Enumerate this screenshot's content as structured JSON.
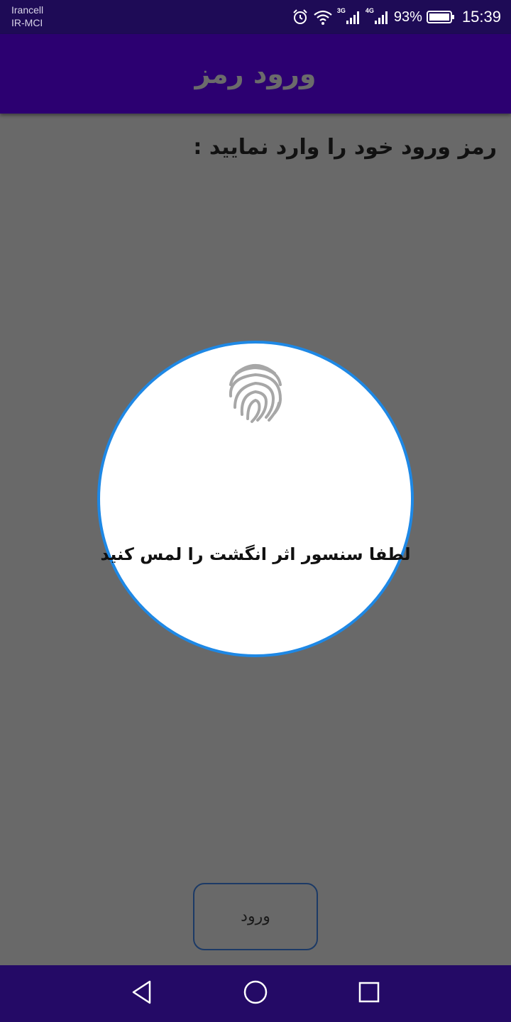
{
  "status_bar": {
    "carrier_primary": "Irancell",
    "carrier_secondary": "IR-MCI",
    "network_1": "3G",
    "network_2": "4G",
    "battery_percent": "93%",
    "time": "15:39",
    "icons": [
      "alarm-icon",
      "wifi-icon",
      "signal-icon",
      "battery-icon"
    ]
  },
  "app_bar": {
    "title": "ورود رمز"
  },
  "main": {
    "prompt": "رمز ورود خود را وارد نمایید :"
  },
  "fingerprint_dialog": {
    "icon": "fingerprint-icon",
    "message": "لطفا سنسور اثر انگشت را لمس کنید"
  },
  "login_button": {
    "label": "ورود"
  },
  "nav_bar": {
    "icons": [
      "back-icon",
      "home-icon",
      "recent-apps-icon"
    ]
  },
  "colors": {
    "status_bar_bg": "#1e0b56",
    "app_bar_bg": "#2c0071",
    "page_bg": "#696969",
    "dialog_border": "#1e88e5",
    "nav_bar_bg": "#240a66"
  }
}
